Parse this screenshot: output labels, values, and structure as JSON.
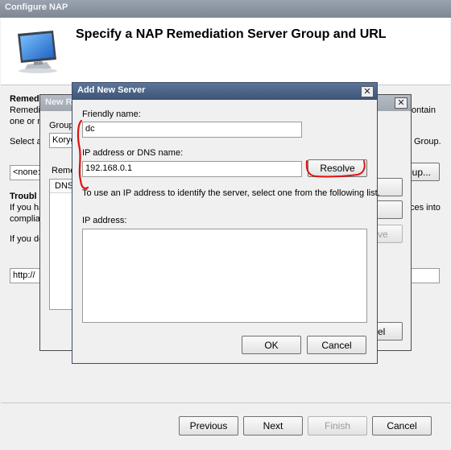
{
  "main_window": {
    "title": "Configure NAP",
    "heading": "Specify a NAP Remediation Server Group and URL",
    "remediation_label": "Remed",
    "remediation_desc_1": "Remedi",
    "remediation_desc_2": "one or m",
    "right_text_contain": "ontain",
    "select_text": "Select a",
    "right_text_group": "Group.",
    "group_select_value": "<none:",
    "group_button_partial": "oup...",
    "trouble_label": "Troubl",
    "trouble_desc_1": "If you ha",
    "trouble_desc_2": "complia",
    "right_text_ces": "ces into",
    "if_you_do": "If you do",
    "url_value": "http://",
    "buttons": {
      "previous": "Previous",
      "next": "Next",
      "finish": "Finish",
      "cancel": "Cancel"
    }
  },
  "middle_dialog": {
    "title": "New R",
    "group_label": "Group",
    "group_value": "Koryg",
    "remed_label": "Reme",
    "column_header": "DNS",
    "remove_partial": "ve",
    "cancel_partial": "el"
  },
  "add_server_dialog": {
    "title": "Add New Server",
    "friendly_name_label": "Friendly name:",
    "friendly_name_value": "dc",
    "ip_dns_label": "IP address or DNS name:",
    "ip_dns_value": "192.168.0.1",
    "resolve_button": "Resolve",
    "hint_text": "To use an IP address to identify the server, select one from the following list.",
    "ip_address_label": "IP address:",
    "ok_button": "OK",
    "cancel_button": "Cancel"
  },
  "annotation_color": "#e01010"
}
